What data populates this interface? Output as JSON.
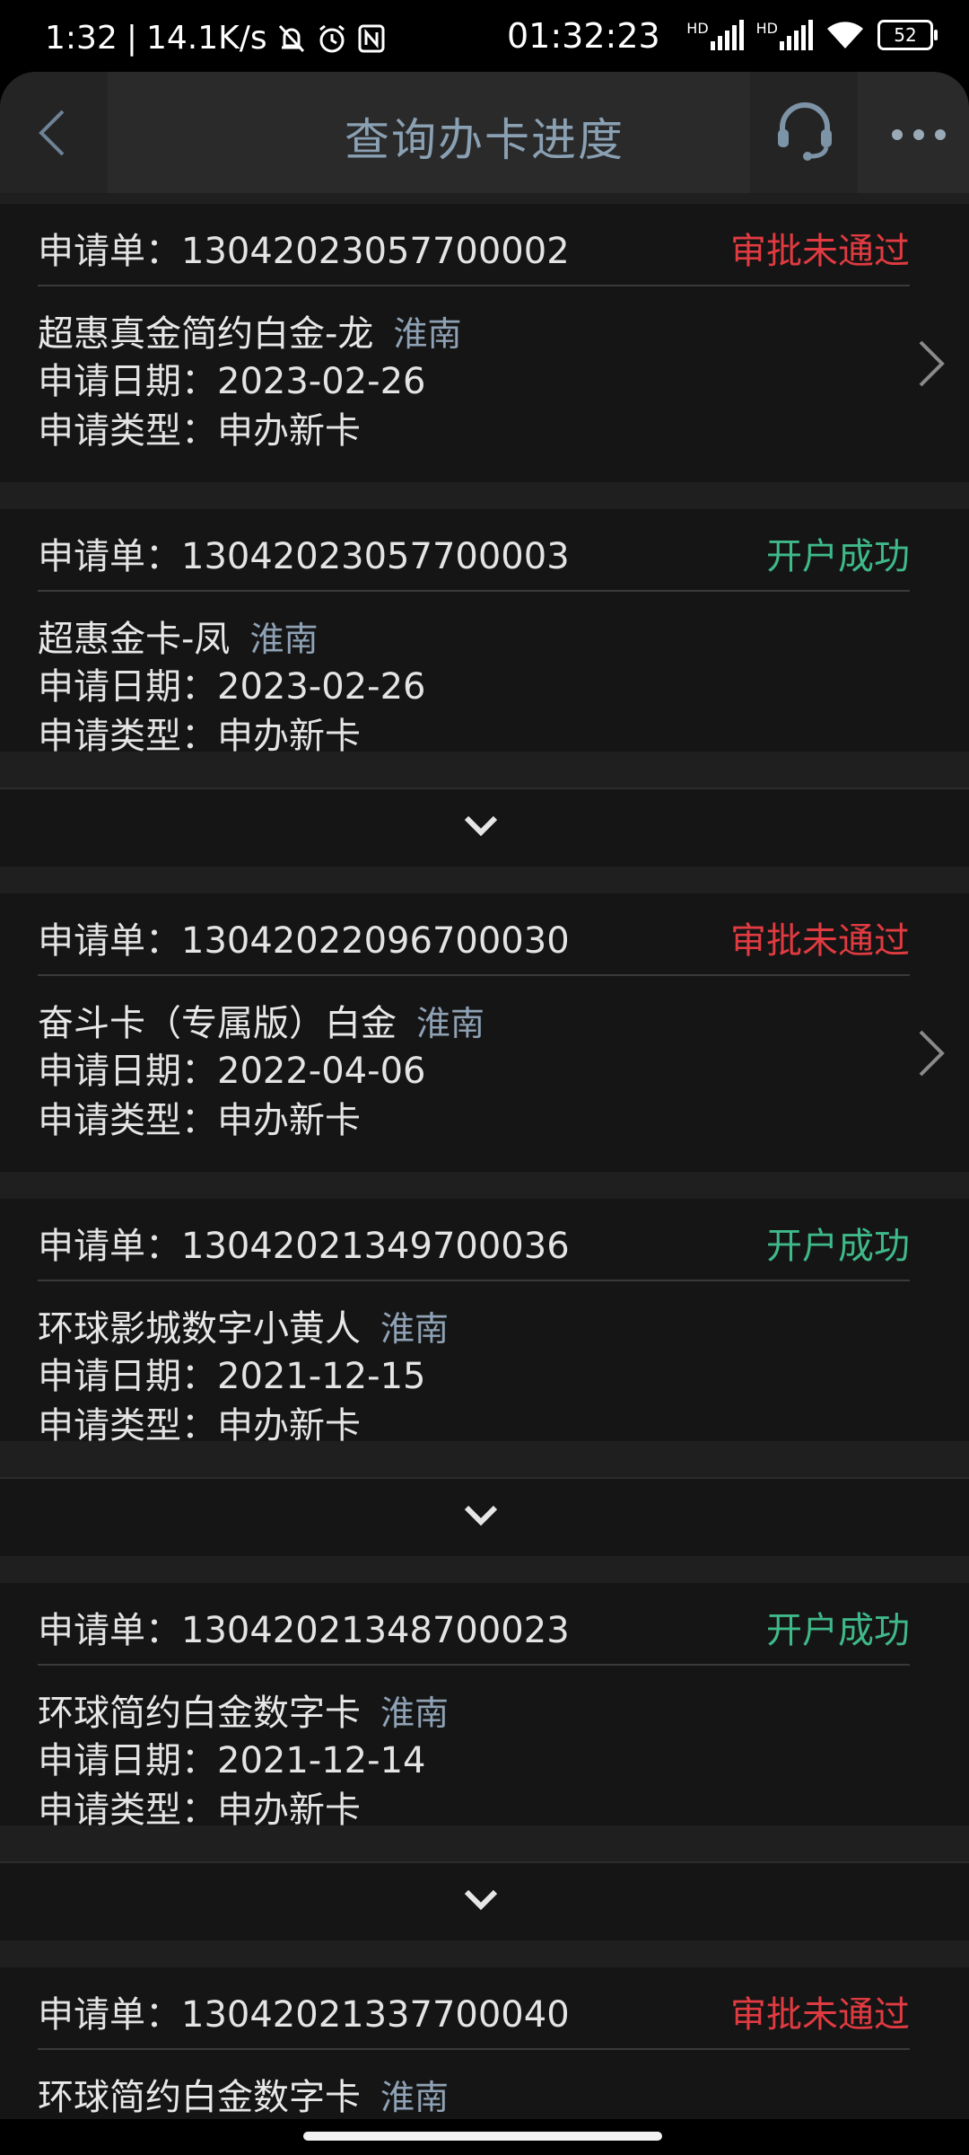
{
  "status_bar": {
    "time": "1:32",
    "net_speed": "14.1K/s",
    "clock": "01:32:23",
    "battery": "52",
    "hd1": "HD",
    "hd2": "HD"
  },
  "header": {
    "title": "查询办卡进度"
  },
  "labels": {
    "app_no": "申请单：",
    "date": "申请日期：",
    "type": "申请类型："
  },
  "cards": [
    {
      "app_no": "13042023057700002",
      "status": "审批未通过",
      "status_color": "#e03b41",
      "name": "超惠真金简约白金-龙",
      "city": "淮南",
      "date": "2023-02-26",
      "type": "申办新卡"
    },
    {
      "app_no": "13042023057700003",
      "status": "开户成功",
      "status_color": "#3fb98a",
      "name": "超惠金卡-凤",
      "city": "淮南",
      "date": "2023-02-26",
      "type": "申办新卡"
    },
    {
      "app_no": "13042022096700030",
      "status": "审批未通过",
      "status_color": "#e03b41",
      "name": "奋斗卡（专属版）白金",
      "city": "淮南",
      "date": "2022-04-06",
      "type": "申办新卡"
    },
    {
      "app_no": "13042021349700036",
      "status": "开户成功",
      "status_color": "#3fb98a",
      "name": "环球影城数字小黄人",
      "city": "淮南",
      "date": "2021-12-15",
      "type": "申办新卡"
    },
    {
      "app_no": "13042021348700023",
      "status": "开户成功",
      "status_color": "#3fb98a",
      "name": "环球简约白金数字卡",
      "city": "淮南",
      "date": "2021-12-14",
      "type": "申办新卡"
    },
    {
      "app_no": "13042021337700040",
      "status": "审批未通过",
      "status_color": "#e03b41",
      "name": "环球简约白金数字卡",
      "city": "淮南"
    }
  ]
}
